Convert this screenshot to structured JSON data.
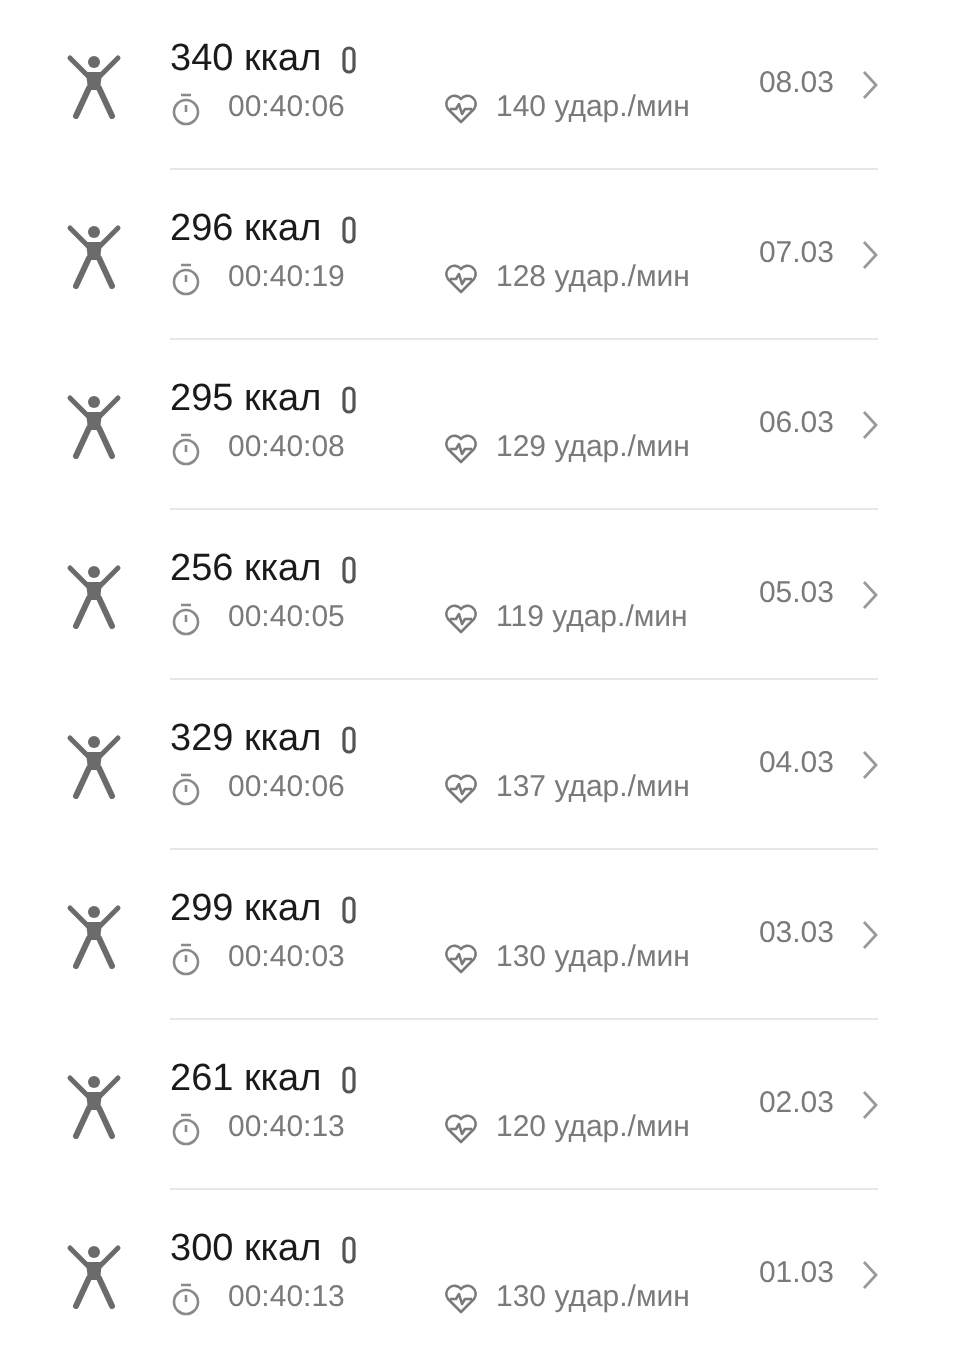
{
  "workouts": [
    {
      "calories": "340 ккал",
      "duration": "00:40:06",
      "heart_rate": "140 удар./мин",
      "date": "08.03"
    },
    {
      "calories": "296 ккал",
      "duration": "00:40:19",
      "heart_rate": "128 удар./мин",
      "date": "07.03"
    },
    {
      "calories": "295 ккал",
      "duration": "00:40:08",
      "heart_rate": "129 удар./мин",
      "date": "06.03"
    },
    {
      "calories": "256 ккал",
      "duration": "00:40:05",
      "heart_rate": "119 удар./мин",
      "date": "05.03"
    },
    {
      "calories": "329 ккал",
      "duration": "00:40:06",
      "heart_rate": "137 удар./мин",
      "date": "04.03"
    },
    {
      "calories": "299 ккал",
      "duration": "00:40:03",
      "heart_rate": "130 удар./мин",
      "date": "03.03"
    },
    {
      "calories": "261 ккал",
      "duration": "00:40:13",
      "heart_rate": "120 удар./мин",
      "date": "02.03"
    },
    {
      "calories": "300 ккал",
      "duration": "00:40:13",
      "heart_rate": "130 удар./мин",
      "date": "01.03"
    }
  ]
}
